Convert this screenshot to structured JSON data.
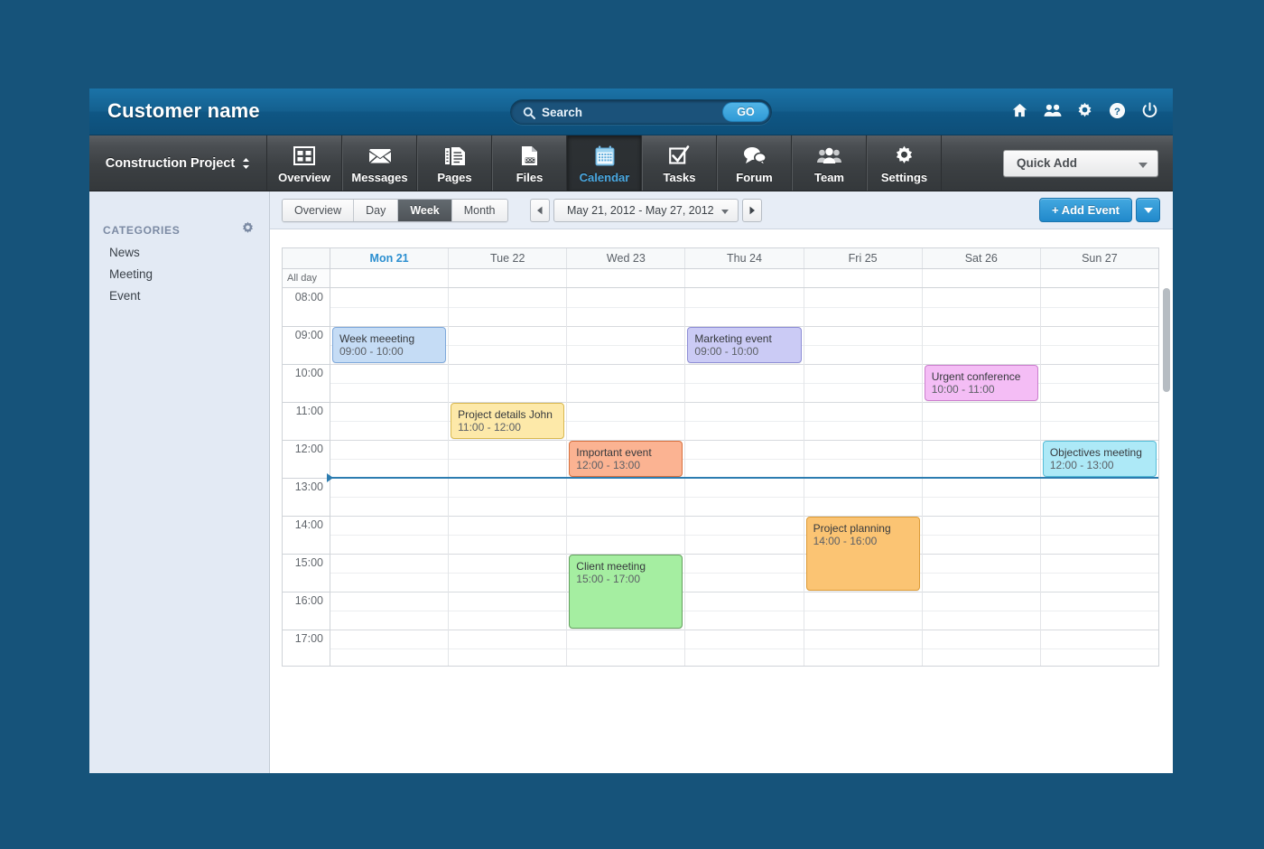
{
  "header": {
    "brand": "Customer name",
    "search": {
      "placeholder": "Search",
      "value": "",
      "go_label": "GO"
    },
    "icons": [
      {
        "name": "home-icon"
      },
      {
        "name": "people-icon"
      },
      {
        "name": "gear-icon"
      },
      {
        "name": "help-icon"
      },
      {
        "name": "power-icon"
      }
    ]
  },
  "nav": {
    "project_label": "Construction Project",
    "items": [
      {
        "label": "Overview",
        "icon": "grid-icon",
        "active": false
      },
      {
        "label": "Messages",
        "icon": "envelope-icon",
        "active": false
      },
      {
        "label": "Pages",
        "icon": "pages-icon",
        "active": false
      },
      {
        "label": "Files",
        "icon": "doc-icon",
        "active": false
      },
      {
        "label": "Calendar",
        "icon": "calendar-icon",
        "active": true
      },
      {
        "label": "Tasks",
        "icon": "checkbox-icon",
        "active": false
      },
      {
        "label": "Forum",
        "icon": "speech-bubbles-icon",
        "active": false
      },
      {
        "label": "Team",
        "icon": "team-icon",
        "active": false
      },
      {
        "label": "Settings",
        "icon": "gear-icon",
        "active": false
      }
    ],
    "quick_add_label": "Quick Add"
  },
  "sidebar": {
    "title": "CATEGORIES",
    "items": [
      {
        "label": "News"
      },
      {
        "label": "Meeting"
      },
      {
        "label": "Event"
      }
    ]
  },
  "toolbar": {
    "views": [
      {
        "label": "Overview",
        "active": false
      },
      {
        "label": "Day",
        "active": false
      },
      {
        "label": "Week",
        "active": true
      },
      {
        "label": "Month",
        "active": false
      }
    ],
    "date_range": "May 21, 2012 - May 27, 2012",
    "prev_label": "◄",
    "next_label": "►",
    "add_event_label": "+ Add Event"
  },
  "calendar": {
    "all_day_label": "All day",
    "days": [
      {
        "label": "Mon 21",
        "today": true
      },
      {
        "label": "Tue 22",
        "today": false
      },
      {
        "label": "Wed 23",
        "today": false
      },
      {
        "label": "Thu 24",
        "today": false
      },
      {
        "label": "Fri 25",
        "today": false
      },
      {
        "label": "Sat 26",
        "today": false
      },
      {
        "label": "Sun 27",
        "today": false
      }
    ],
    "hours": [
      "08:00",
      "09:00",
      "10:00",
      "11:00",
      "12:00",
      "13:00",
      "14:00",
      "15:00",
      "16:00",
      "17:00"
    ],
    "current_time_marker": "13:00",
    "events": [
      {
        "title": "Week meeeting",
        "time": "09:00 - 10:00",
        "day": 0,
        "start": "09:00",
        "end": "10:00",
        "bg": "#c5dcf5",
        "border": "#7ea8da"
      },
      {
        "title": "Project details John",
        "time": "11:00 - 12:00",
        "day": 1,
        "start": "11:00",
        "end": "12:00",
        "bg": "#fde9a9",
        "border": "#d9b84e"
      },
      {
        "title": "Important event",
        "time": "12:00 - 13:00",
        "day": 2,
        "start": "12:00",
        "end": "13:00",
        "bg": "#fbb392",
        "border": "#d8713e"
      },
      {
        "title": "Client meeting",
        "time": "15:00 - 17:00",
        "day": 2,
        "start": "15:00",
        "end": "17:00",
        "bg": "#a5eea1",
        "border": "#64a05f"
      },
      {
        "title": "Marketing event",
        "time": "09:00 - 10:00",
        "day": 3,
        "start": "09:00",
        "end": "10:00",
        "bg": "#cbcbf5",
        "border": "#8e8ed6"
      },
      {
        "title": "Project planning",
        "time": "14:00 - 16:00",
        "day": 4,
        "start": "14:00",
        "end": "16:00",
        "bg": "#fbc473",
        "border": "#dd9b36"
      },
      {
        "title": "Urgent conference",
        "time": "10:00 - 11:00",
        "day": 5,
        "start": "10:00",
        "end": "11:00",
        "bg": "#f4bdf5",
        "border": "#cb7ecd"
      },
      {
        "title": "Objectives meeting",
        "time": "12:00 - 13:00",
        "day": 6,
        "start": "12:00",
        "end": "13:00",
        "bg": "#ade9f7",
        "border": "#57bdd8"
      }
    ]
  },
  "colors": {
    "page_background": "#16537a",
    "topbar": "#14608f",
    "navbar": "#3c4043",
    "accent": "#2b8fd0",
    "sidebar": "#e3eaf4",
    "toolbar": "#e7edf6"
  }
}
